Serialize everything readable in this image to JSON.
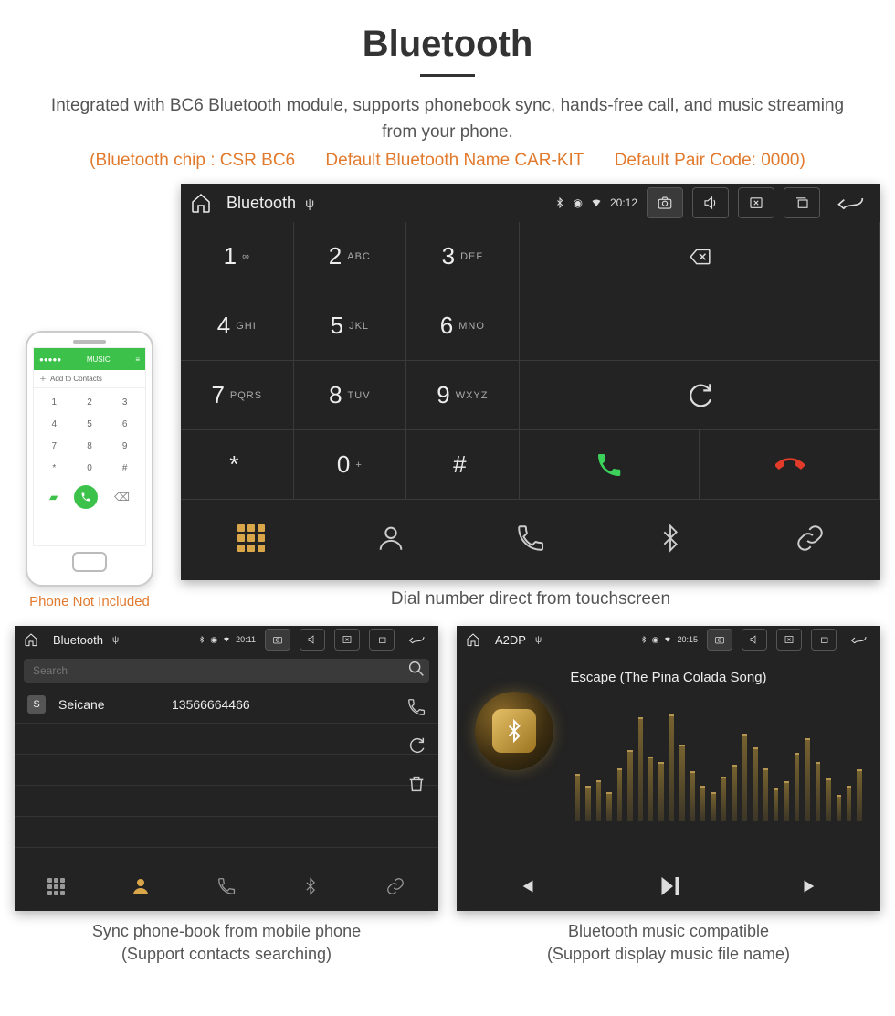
{
  "title": "Bluetooth",
  "intro": "Integrated with BC6 Bluetooth module, supports phonebook sync, hands-free call, and music streaming from your phone.",
  "specs": {
    "chip": "(Bluetooth chip : CSR BC6",
    "name": "Default Bluetooth Name CAR-KIT",
    "code": "Default Pair Code: 0000)"
  },
  "phone": {
    "header_title": "MUSIC",
    "add_contacts": "Add to Contacts",
    "keys": [
      "1",
      "2",
      "3",
      "4",
      "5",
      "6",
      "7",
      "8",
      "9",
      "*",
      "0",
      "#"
    ],
    "caption": "Phone Not Included"
  },
  "dialer": {
    "statusbar": {
      "title": "Bluetooth",
      "time": "20:12"
    },
    "keys": [
      {
        "d": "1",
        "l": "∞"
      },
      {
        "d": "2",
        "l": "ABC"
      },
      {
        "d": "3",
        "l": "DEF"
      },
      {
        "d": "4",
        "l": "GHI"
      },
      {
        "d": "5",
        "l": "JKL"
      },
      {
        "d": "6",
        "l": "MNO"
      },
      {
        "d": "7",
        "l": "PQRS"
      },
      {
        "d": "8",
        "l": "TUV"
      },
      {
        "d": "9",
        "l": "WXYZ"
      },
      {
        "d": "*",
        "l": ""
      },
      {
        "d": "0",
        "l": "+"
      },
      {
        "d": "#",
        "l": ""
      }
    ],
    "caption": "Dial number direct from touchscreen"
  },
  "phonebook": {
    "statusbar": {
      "title": "Bluetooth",
      "time": "20:11"
    },
    "search_placeholder": "Search",
    "contact": {
      "badge": "S",
      "name": "Seicane",
      "number": "13566664466"
    },
    "caption_line1": "Sync phone-book from mobile phone",
    "caption_line2": "(Support contacts searching)"
  },
  "music": {
    "statusbar": {
      "title": "A2DP",
      "time": "20:15"
    },
    "track": "Escape (The Pina Colada Song)",
    "eq_heights": [
      40,
      30,
      35,
      25,
      45,
      60,
      88,
      55,
      50,
      90,
      65,
      42,
      30,
      25,
      38,
      48,
      74,
      62,
      45,
      28,
      34,
      58,
      70,
      50,
      36,
      22,
      30,
      44
    ],
    "caption_line1": "Bluetooth music compatible",
    "caption_line2": "(Support display music file name)"
  }
}
